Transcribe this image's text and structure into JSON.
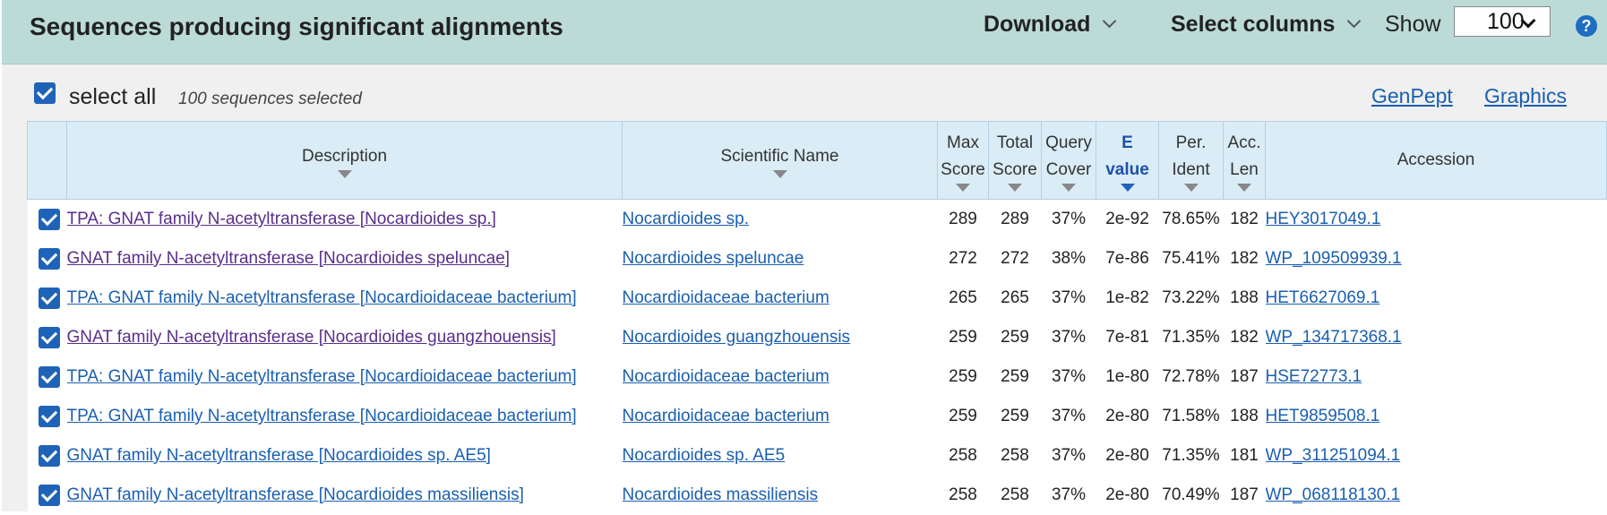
{
  "header": {
    "title": "Sequences producing significant alignments",
    "download_label": "Download",
    "select_columns_label": "Select columns",
    "show_label": "Show",
    "show_value": "100",
    "help_icon": "question-circle-icon"
  },
  "selection": {
    "select_all_label": "select all",
    "selected_count": "100 sequences selected",
    "genpept_label": "GenPept",
    "graphics_label": "Graphics"
  },
  "columns": {
    "description": "Description",
    "scientific_name": "Scientific Name",
    "max_score_1": "Max",
    "max_score_2": "Score",
    "total_score_1": "Total",
    "total_score_2": "Score",
    "query_cover_1": "Query",
    "query_cover_2": "Cover",
    "evalue_1": "E",
    "evalue_2": "value",
    "per_ident_1": "Per.",
    "per_ident_2": "Ident",
    "acc_len_1": "Acc.",
    "acc_len_2": "Len",
    "accession": "Accession"
  },
  "colors": {
    "header_bg": "#bcdbd7",
    "link": "#1a5fb0",
    "visited": "#5a2e8a",
    "checkbox": "#1f63b8"
  },
  "rows": [
    {
      "description": "TPA: GNAT family N-acetyltransferase [Nocardioides sp.]",
      "visited": true,
      "scientific_name": "Nocardioides sp.",
      "max_score": "289",
      "total_score": "289",
      "query_cover": "37%",
      "evalue": "2e-92",
      "per_ident": "78.65%",
      "acc_len": "182",
      "accession": "HEY3017049.1"
    },
    {
      "description": "GNAT family N-acetyltransferase [Nocardioides speluncae]",
      "visited": true,
      "scientific_name": "Nocardioides speluncae",
      "max_score": "272",
      "total_score": "272",
      "query_cover": "38%",
      "evalue": "7e-86",
      "per_ident": "75.41%",
      "acc_len": "182",
      "accession": "WP_109509939.1"
    },
    {
      "description": "TPA: GNAT family N-acetyltransferase [Nocardioidaceae bacterium]",
      "visited": false,
      "scientific_name": "Nocardioidaceae bacterium",
      "max_score": "265",
      "total_score": "265",
      "query_cover": "37%",
      "evalue": "1e-82",
      "per_ident": "73.22%",
      "acc_len": "188",
      "accession": "HET6627069.1"
    },
    {
      "description": "GNAT family N-acetyltransferase [Nocardioides guangzhouensis]",
      "visited": true,
      "scientific_name": "Nocardioides guangzhouensis",
      "max_score": "259",
      "total_score": "259",
      "query_cover": "37%",
      "evalue": "7e-81",
      "per_ident": "71.35%",
      "acc_len": "182",
      "accession": "WP_134717368.1"
    },
    {
      "description": "TPA: GNAT family N-acetyltransferase [Nocardioidaceae bacterium]",
      "visited": false,
      "scientific_name": "Nocardioidaceae bacterium",
      "max_score": "259",
      "total_score": "259",
      "query_cover": "37%",
      "evalue": "1e-80",
      "per_ident": "72.78%",
      "acc_len": "187",
      "accession": "HSE72773.1"
    },
    {
      "description": "TPA: GNAT family N-acetyltransferase [Nocardioidaceae bacterium]",
      "visited": false,
      "scientific_name": "Nocardioidaceae bacterium",
      "max_score": "259",
      "total_score": "259",
      "query_cover": "37%",
      "evalue": "2e-80",
      "per_ident": "71.58%",
      "acc_len": "188",
      "accession": "HET9859508.1"
    },
    {
      "description": "GNAT family N-acetyltransferase [Nocardioides sp. AE5]",
      "visited": false,
      "scientific_name": "Nocardioides sp. AE5",
      "max_score": "258",
      "total_score": "258",
      "query_cover": "37%",
      "evalue": "2e-80",
      "per_ident": "71.35%",
      "acc_len": "181",
      "accession": "WP_311251094.1"
    },
    {
      "description": "GNAT family N-acetyltransferase [Nocardioides massiliensis]",
      "visited": false,
      "scientific_name": "Nocardioides massiliensis",
      "max_score": "258",
      "total_score": "258",
      "query_cover": "37%",
      "evalue": "2e-80",
      "per_ident": "70.49%",
      "acc_len": "187",
      "accession": "WP_068118130.1"
    }
  ]
}
